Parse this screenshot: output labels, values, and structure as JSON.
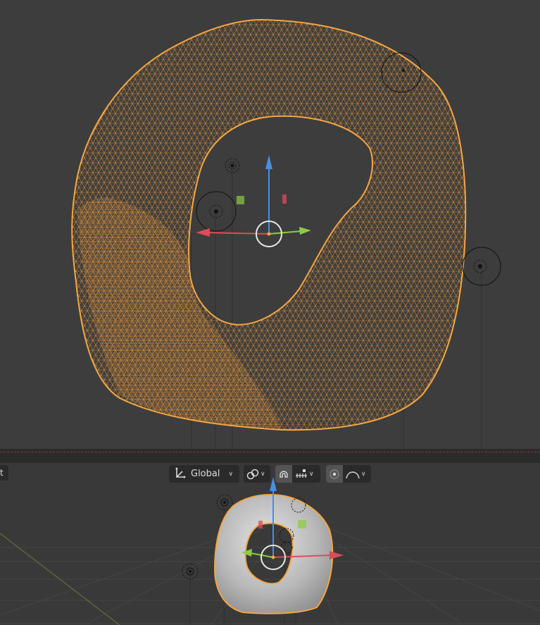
{
  "header": {
    "mode_stub_label": "t"
  },
  "toolbar": {
    "transform_orientation": "Global",
    "pivot_icon": "pivot-point-icon",
    "snap_icon": "snap-magnet-icon",
    "snap_target_icon": "snap-increment-icon",
    "proportional_icon": "proportional-edit-icon",
    "falloff_icon": "falloff-curve-icon"
  },
  "colors": {
    "wire": "#f0a040",
    "viewport_bg": "#3d3d3d",
    "x_axis": "#e04a5a",
    "y_axis": "#8ccc40",
    "z_axis": "#4a8ee0"
  }
}
